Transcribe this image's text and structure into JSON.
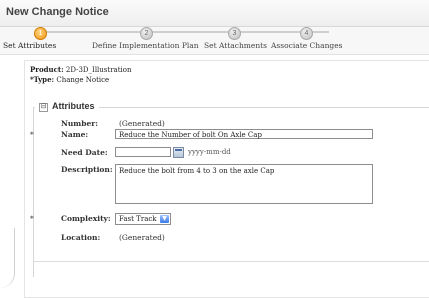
{
  "window": {
    "title": "New Change Notice"
  },
  "steps": [
    {
      "number": "1",
      "label": "Set Attributes",
      "active": true
    },
    {
      "number": "2",
      "label": "Define Implementation Plan",
      "active": false
    },
    {
      "number": "3",
      "label": "Set Attachments",
      "active": false
    },
    {
      "number": "4",
      "label": "Associate Changes",
      "active": false
    }
  ],
  "info": {
    "product_label": "Product:",
    "product_value": "2D-3D_Illustration",
    "type_label": "*Type:",
    "type_value": "Change Notice"
  },
  "attributes": {
    "legend": "Attributes",
    "toggle": "⊟",
    "number_label": "Number:",
    "number_value": "(Generated)",
    "name_label": "Name:",
    "name_value": "Reduce the Number of bolt On Axle Cap",
    "need_date_label": "Need Date:",
    "need_date_value": "",
    "need_date_hint": "yyyy-mm-dd",
    "description_label": "Description:",
    "description_value": "Reduce the bolt from 4 to 3 on the axle Cap",
    "complexity_label": "Complexity:",
    "complexity_value": "Fast Track",
    "location_label": "Location:",
    "location_value": "(Generated)",
    "required_marker": "*"
  }
}
